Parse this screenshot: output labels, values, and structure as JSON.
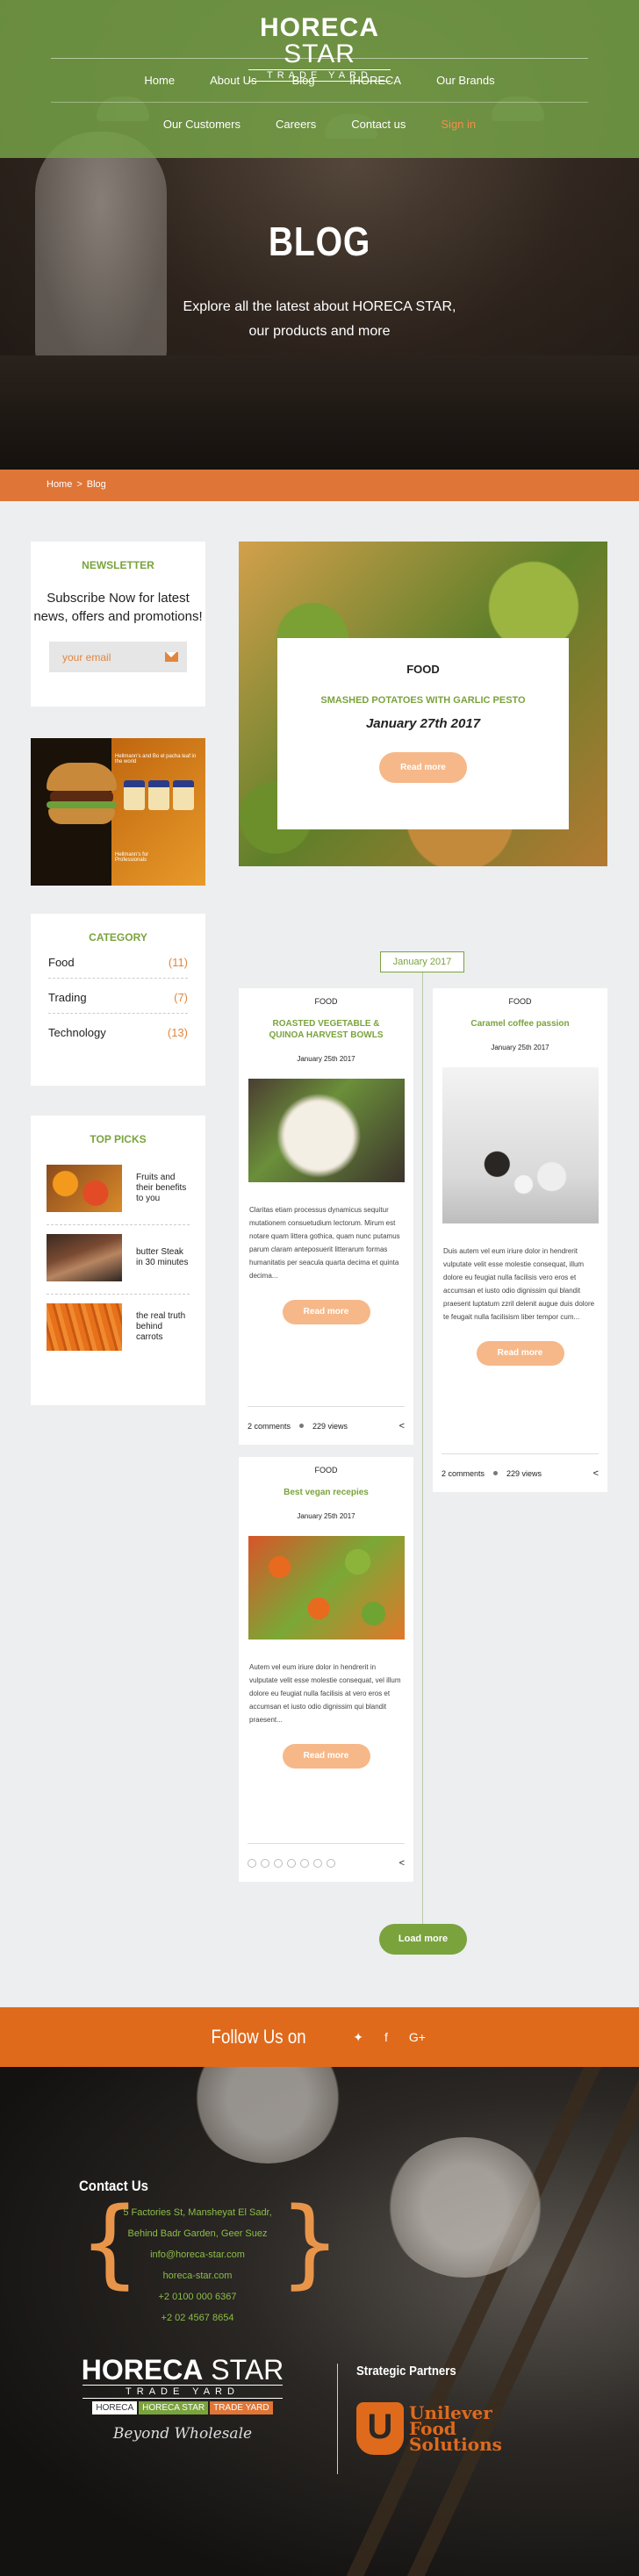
{
  "brand": {
    "name_bold": "HORECA",
    "name_light": " STAR",
    "sub": "TRADE YARD"
  },
  "nav": {
    "row1": [
      "Home",
      "About Us",
      "Blog",
      "iHORECA",
      "Our Brands"
    ],
    "row2": [
      "Our Customers",
      "Careers",
      "Contact us",
      "Sign in"
    ]
  },
  "hero": {
    "title": "BLOG",
    "subtitle": "Explore all the latest about HORECA STAR, our products and more"
  },
  "breadcrumb": {
    "home": "Home",
    "sep": ">",
    "current": "Blog"
  },
  "newsletter": {
    "heading": "NEWSLETTER",
    "text": "Subscribe Now for latest news, offers and promotions!",
    "placeholder": "your email"
  },
  "ad": {
    "headline": "Hellmann's and Bo el pacha leaf in the world",
    "footer": "Hellmann's for Professionals"
  },
  "category": {
    "heading": "CATEGORY",
    "items": [
      {
        "label": "Food",
        "count": "(11)"
      },
      {
        "label": "Trading",
        "count": "(7)"
      },
      {
        "label": "Technology",
        "count": "(13)"
      }
    ]
  },
  "top_picks": {
    "heading": "TOP PICKS",
    "items": [
      {
        "text": "Fruits and their benefits to you"
      },
      {
        "text": "butter Steak in 30 minutes"
      },
      {
        "text": "the real truth behind carrots"
      }
    ]
  },
  "featured": {
    "tag": "FOOD",
    "title": "SMASHED POTATOES WITH GARLIC PESTO",
    "date": "January 27th 2017",
    "button": "Read more"
  },
  "timeline_label": "January 2017",
  "posts": [
    {
      "tag": "FOOD",
      "title": "ROASTED VEGETABLE & QUINOA HARVEST BOWLS",
      "date": "January 25th 2017",
      "text": "Claritas etiam processus dynamicus sequitur mutationem consuetudium lectorum. Mirum est notare quam littera gothica, quam nunc putamus parum claram anteposuerit litterarum formas humanitatis per seacula quarta decima et quinta decima...",
      "button": "Read more",
      "comments": "2 comments",
      "views": "229 views"
    },
    {
      "tag": "FOOD",
      "title": "Caramel coffee passion",
      "date": "January 25th 2017",
      "text": "Duis autem vel eum iriure dolor in hendrerit vulputate velit esse molestie consequat, illum dolore eu feugiat nulla facilisis vero eros et accumsan et iusto odio dignissim qui blandit praesent luptatum zzril delenit augue duis dolore te feugait nulla facilisism liber tempor cum...",
      "button": "Read more",
      "comments": "2 comments",
      "views": "229 views"
    },
    {
      "tag": "FOOD",
      "title": "Best vegan recepies",
      "date": "January 25th 2017",
      "text": "Autem vel eum iriure dolor in hendrerit in vulputate velit esse molestie consequat, vel illum dolore eu feugiat nulla facilisis at vero eros et accumsan et iusto odio dignissim qui blandit praesent...",
      "button": "Read more"
    }
  ],
  "load_more": "Load more",
  "follow": {
    "label": "Follow Us on",
    "icons": [
      "twitter-icon",
      "facebook-icon",
      "google-plus-icon"
    ]
  },
  "contact": {
    "heading": "Contact Us",
    "lines": [
      "5 Factories St, Mansheyat El Sadr,",
      "Behind Badr Garden, Geer Suez",
      "info@horeca-star.com",
      "horeca-star.com",
      "+2 0100 000 6367",
      "+2 02 4567 8654"
    ]
  },
  "footer_logo": {
    "name_bold": "HORECA",
    "name_light": " STAR",
    "sub": "TRADE YARD",
    "chips": [
      "HORECA",
      "HORECA STAR",
      "TRADE YARD"
    ],
    "tagline": "Beyond Wholesale"
  },
  "partners": {
    "heading": "Strategic Partners",
    "name_line1": "Unilever",
    "name_line2": "Food",
    "name_line3": "Solutions"
  },
  "colors": {
    "green": "#7aa33d",
    "orange": "#df7536",
    "peach": "#f6b889"
  }
}
